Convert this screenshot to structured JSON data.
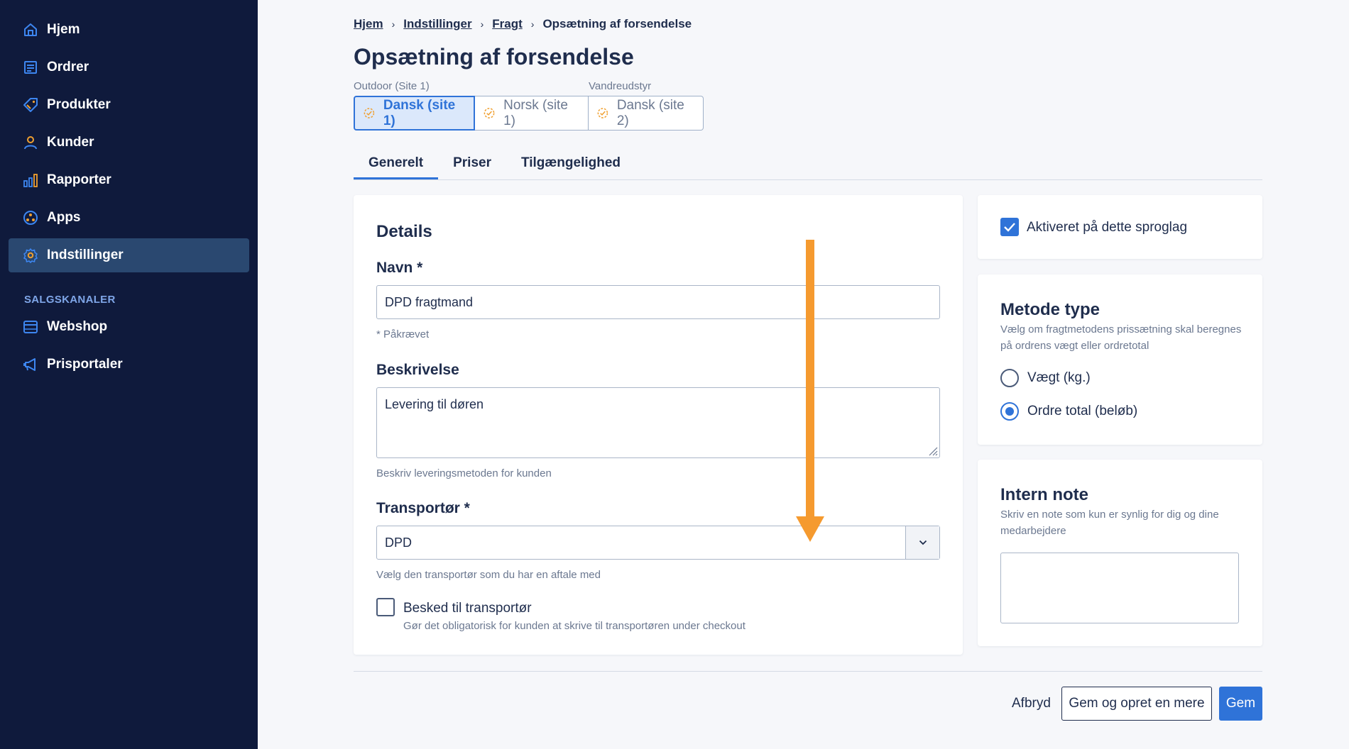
{
  "sidebar": {
    "items": [
      {
        "label": "Hjem",
        "icon": "home-icon"
      },
      {
        "label": "Ordrer",
        "icon": "orders-icon"
      },
      {
        "label": "Produkter",
        "icon": "tag-icon"
      },
      {
        "label": "Kunder",
        "icon": "user-icon"
      },
      {
        "label": "Rapporter",
        "icon": "bar-chart-icon"
      },
      {
        "label": "Apps",
        "icon": "apps-icon"
      },
      {
        "label": "Indstillinger",
        "icon": "gear-icon",
        "active": true
      }
    ],
    "section_title": "SALGSKANALER",
    "channels": [
      {
        "label": "Webshop",
        "icon": "browser-icon"
      },
      {
        "label": "Prisportaler",
        "icon": "megaphone-icon"
      }
    ]
  },
  "breadcrumb": {
    "items": [
      "Hjem",
      "Indstillinger",
      "Fragt"
    ],
    "current": "Opsætning af forsendelse"
  },
  "page_title": "Opsætning af forsendelse",
  "site_groups": {
    "group1_label": "Outdoor (Site 1)",
    "group2_label": "Vandreudstyr",
    "tabs": [
      {
        "label": "Dansk (site 1)",
        "active": true
      },
      {
        "label": "Norsk (site 1)",
        "active": false
      },
      {
        "label": "Dansk (site 2)",
        "active": false
      }
    ]
  },
  "tabs": [
    {
      "label": "Generelt",
      "active": true
    },
    {
      "label": "Priser",
      "active": false
    },
    {
      "label": "Tilgængelighed",
      "active": false
    }
  ],
  "details": {
    "title": "Details",
    "name_label": "Navn *",
    "name_value": "DPD fragtmand",
    "required_note": "* Påkrævet",
    "description_label": "Beskrivelse",
    "description_value": "Levering til døren",
    "description_help": "Beskriv leveringsmetoden for kunden",
    "carrier_label": "Transportør *",
    "carrier_value": "DPD",
    "carrier_help": "Vælg den transportør som du har en aftale med",
    "message_label": "Besked til transportør",
    "message_help": "Gør det obligatorisk for kunden at skrive til transportøren under checkout",
    "message_checked": false
  },
  "activation": {
    "label": "Aktiveret på dette sproglag",
    "checked": true
  },
  "method_type": {
    "title": "Metode type",
    "description": "Vælg om fragtmetodens prissætning skal beregnes på ordrens vægt eller ordretotal",
    "options": [
      {
        "label": "Vægt (kg.)",
        "checked": false
      },
      {
        "label": "Ordre total (beløb)",
        "checked": true
      }
    ]
  },
  "internal_note": {
    "title": "Intern note",
    "description": "Skriv en note som kun er synlig for dig og dine medarbejdere",
    "value": ""
  },
  "footer": {
    "cancel": "Afbryd",
    "save_and_new": "Gem og opret en mere",
    "save": "Gem"
  },
  "colors": {
    "sidebar_bg": "#0f1a3c",
    "accent": "#2f73d8",
    "annotation_arrow": "#f59a2f",
    "status_icon": "#f0a030"
  }
}
